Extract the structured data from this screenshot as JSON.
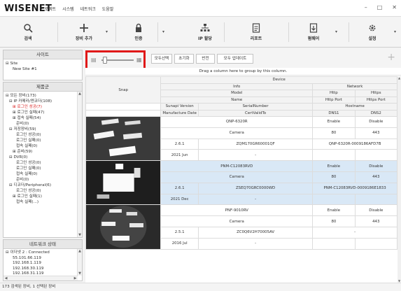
{
  "app": {
    "logo": "WISENET",
    "menu": [
      "프로젝트",
      "시스템",
      "네트워크",
      "도움말"
    ],
    "window_controls": [
      "–",
      "□",
      "✕"
    ]
  },
  "toolbar": {
    "buttons": [
      {
        "label": "검색",
        "icon": "search-icon"
      },
      {
        "label": "장비 추가",
        "icon": "plus-icon"
      },
      {
        "label": "인증",
        "icon": "lock-icon"
      },
      {
        "label": "IP 할당",
        "icon": "network-icon"
      },
      {
        "label": "리포트",
        "icon": "report-icon"
      },
      {
        "label": "펌웨어",
        "icon": "firmware-icon"
      },
      {
        "label": "설정",
        "icon": "gear-icon"
      }
    ]
  },
  "site_panel": {
    "title": "사이트",
    "root": "Site",
    "child": "New Site #1"
  },
  "device_panel": {
    "title": "제품군",
    "items": [
      {
        "text": "⊟ 모든 장비(173)",
        "indent": 0,
        "red": false
      },
      {
        "text": "⊟ IP 카메라/엔코더(108)",
        "indent": 1,
        "red": false
      },
      {
        "text": "⊞ 로그인 성공(7)",
        "indent": 2,
        "red": true
      },
      {
        "text": "⊞ 로그인 실패(47)",
        "indent": 2,
        "red": false
      },
      {
        "text": "⊞ 접속 실패(54)",
        "indent": 2,
        "red": false
      },
      {
        "text": "준비(0)",
        "indent": 3,
        "red": false
      },
      {
        "text": "⊟ 저장장비(59)",
        "indent": 1,
        "red": false
      },
      {
        "text": "로그인 성공(0)",
        "indent": 3,
        "red": false
      },
      {
        "text": "로그인 실패(0)",
        "indent": 3,
        "red": false
      },
      {
        "text": "접속 실패(0)",
        "indent": 3,
        "red": false
      },
      {
        "text": "⊞ 준비(59)",
        "indent": 2,
        "red": false
      },
      {
        "text": "⊟ DVR(0)",
        "indent": 1,
        "red": false
      },
      {
        "text": "로그인 성공(0)",
        "indent": 3,
        "red": false
      },
      {
        "text": "로그인 실패(0)",
        "indent": 3,
        "red": false
      },
      {
        "text": "접속 실패(0)",
        "indent": 3,
        "red": false
      },
      {
        "text": "준비(0)",
        "indent": 3,
        "red": false
      },
      {
        "text": "⊟ 디코더/Peripheral(6)",
        "indent": 1,
        "red": false
      },
      {
        "text": "로그인 성공(0)",
        "indent": 3,
        "red": false
      },
      {
        "text": "⊞ 로그인 실패(1)",
        "indent": 2,
        "red": false
      },
      {
        "text": "접속 실패(...)",
        "indent": 3,
        "red": false
      }
    ]
  },
  "network_panel": {
    "title": "네트워크 상태",
    "items": [
      "⊟ 이더넷 2 : Connected",
      "55.101.66.119",
      "192.168.1.119",
      "192.168.30.119",
      "192.168.31.119",
      "192.168.32.119"
    ]
  },
  "controls": {
    "select_all": "모두선택",
    "reset": "초기화",
    "invert": "반전",
    "update_all": "모두 업데이트"
  },
  "group_hint": "Drag a column here to group by this column.",
  "table": {
    "headers": {
      "snap": "Snap",
      "device": "Device",
      "info": "Info",
      "network": "Network",
      "model": "Model",
      "http": "Http",
      "https": "Https",
      "name": "Name",
      "http_port": "Http Port",
      "https_port": "Https Port",
      "sunapi": "Sunapi Version",
      "serial": "SerialNumber",
      "hostname": "Hostname",
      "mfg": "Manufacture Date",
      "cert": "CertValidTo",
      "dns1": "DNS1",
      "dns2": "DNS2"
    },
    "rows": [
      {
        "model": "QNP-6320R",
        "http": "Enable",
        "https": "Disable",
        "name": "Camera",
        "http_port": "80",
        "https_port": "443",
        "sunapi": "2.6.1",
        "serial": "ZQM170GR60001QF",
        "hostname": "QNP-6320R-0009186AFD7B",
        "mfg": "2021 Jun",
        "cert": "-",
        "dns1": "",
        "dns2": "",
        "selected": false
      },
      {
        "model": "PNM-C12083RVD",
        "http": "Enable",
        "https": "Disable",
        "name": "Camera",
        "http_port": "80",
        "https_port": "443",
        "sunapi": "2.6.1",
        "serial": "ZSEQ70GRC0000WD",
        "hostname": "PNM-C12083RVD-0009186E1833",
        "mfg": "2021 Dec",
        "cert": "-",
        "dns1": "",
        "dns2": "",
        "selected": true
      },
      {
        "model": "PNF-9010RV",
        "http": "Enable",
        "https": "Disable",
        "name": "Camera",
        "http_port": "80",
        "https_port": "443",
        "sunapi": "2.5.1",
        "serial": "ZC0Q6V2H70005AV",
        "hostname": "-",
        "mfg": "2016 Jul",
        "cert": "-",
        "dns1": "",
        "dns2": "",
        "selected": false
      }
    ]
  },
  "status_bar": "173 검색된 장비, 1 선택된 장비"
}
